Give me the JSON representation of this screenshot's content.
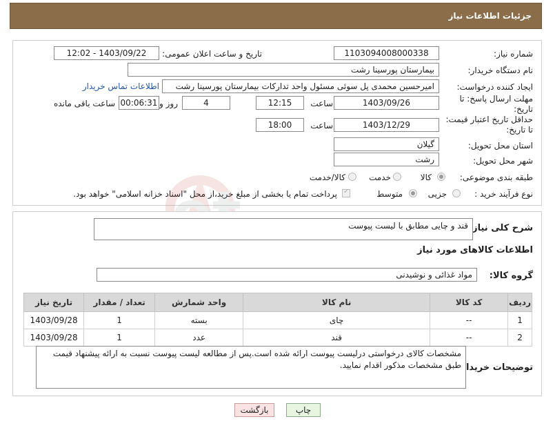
{
  "header": {
    "title": "جزئیات اطلاعات نیاز"
  },
  "form": {
    "need_number": {
      "label": "شماره نیاز:",
      "value": "1103094008000338"
    },
    "announce": {
      "label": "تاریخ و ساعت اعلان عمومی:",
      "value": "1403/09/22 - 12:02"
    },
    "buyer_org": {
      "label": "نام دستگاه خریدار:",
      "value": "بیمارستان پورسینا رشت"
    },
    "requester": {
      "label": "ایجاد کننده درخواست:",
      "value": "امیرحسین محمدی پل سوئی مسئول واحد تدارکات بیمارستان پورسینا رشت",
      "contact_link": "اطلاعات تماس خریدار"
    },
    "deadline": {
      "label": "مهلت ارسال پاسخ: تا تاریخ:",
      "date": "1403/09/26",
      "time_label": "ساعت",
      "time": "12:15",
      "days": "4",
      "days_label": "روز و",
      "remaining": "00:06:31",
      "remaining_label": "ساعت باقی مانده"
    },
    "price_validity": {
      "label": "حداقل تاریخ اعتبار قیمت: تا تاریخ:",
      "date": "1403/12/29",
      "time_label": "ساعت",
      "time": "18:00"
    },
    "province": {
      "label": "استان محل تحویل:",
      "value": "گیلان"
    },
    "city": {
      "label": "شهر محل تحویل:",
      "value": "رشت"
    },
    "category": {
      "label": "طبقه بندی موضوعی:",
      "options": [
        "کالا",
        "خدمت",
        "کالا/خدمت"
      ],
      "selected": "کالا"
    },
    "process": {
      "label": "نوع فرآیند خرید :",
      "options": [
        "جزیی",
        "متوسط"
      ],
      "selected": "متوسط",
      "payment_note": "پرداخت تمام یا بخشی از مبلغ خرید،از محل \"اسناد خزانه اسلامی\" خواهد بود."
    }
  },
  "description": {
    "label": "شرح کلی نیاز:",
    "value": "قند و چایی مطابق با لیست پیوست"
  },
  "goods": {
    "section_title": "اطلاعات کالاهای مورد نیاز",
    "group_label": "گروه کالا:",
    "group_value": "مواد غذائی و نوشیدنی",
    "columns": [
      "ردیف",
      "کد کالا",
      "نام کالا",
      "واحد شمارش",
      "تعداد / مقدار",
      "تاریخ نیاز"
    ],
    "rows": [
      [
        "1",
        "--",
        "چای",
        "بسته",
        "1",
        "1403/09/28"
      ],
      [
        "2",
        "--",
        "قند",
        "عدد",
        "1",
        "1403/09/28"
      ]
    ]
  },
  "buyer_notes": {
    "label": "توضیحات خریدار:",
    "value": "مشخصات کالای درخواستی درلیست پیوست ارائه شده است.پس از مطالعه لیست پیوست نسبت به ارائه پیشنهاد قیمت طبق مشخصات مذکور اقدام نمایید."
  },
  "buttons": {
    "print": "چاپ",
    "back": "بازگشت"
  },
  "watermark": "AriaTender.net",
  "colors": {
    "header_bg": "#8b6d4a",
    "link": "#2255aa",
    "back_button_bg": "#fbe3e3",
    "print_button_bg": "#e7f5e1"
  }
}
